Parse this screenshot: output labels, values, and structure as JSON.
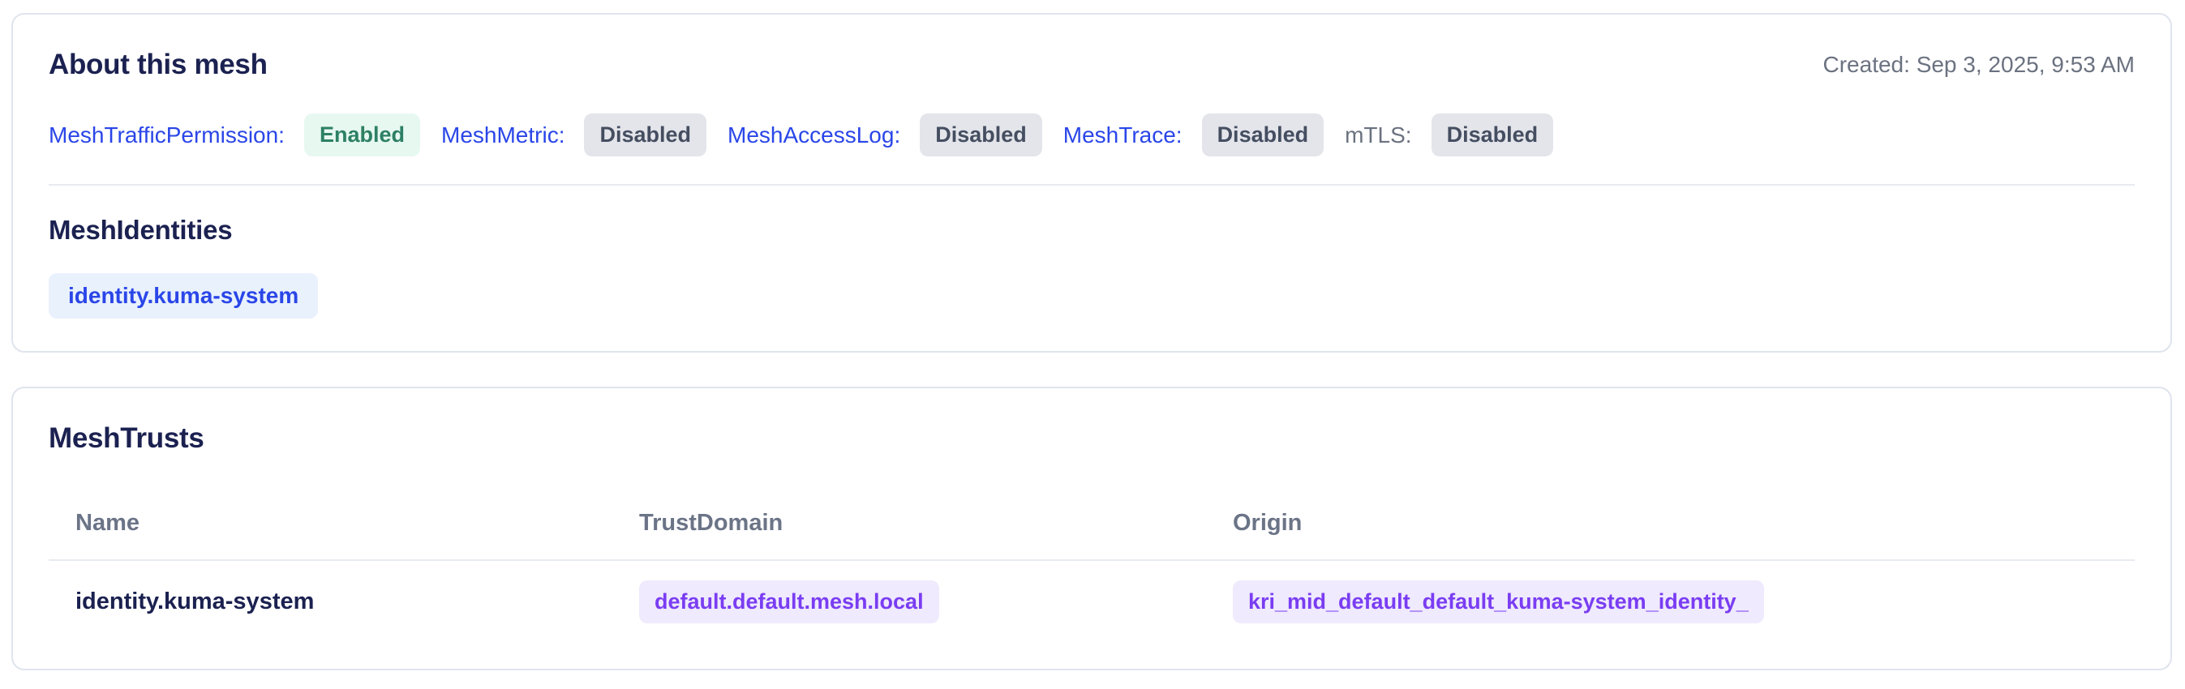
{
  "about_card": {
    "title": "About this mesh",
    "created": "Created: Sep 3, 2025, 9:53 AM",
    "policies": [
      {
        "label": "MeshTrafficPermission:",
        "status": "Enabled",
        "variant": "enabled",
        "is_link": true
      },
      {
        "label": "MeshMetric:",
        "status": "Disabled",
        "variant": "disabled",
        "is_link": true
      },
      {
        "label": "MeshAccessLog:",
        "status": "Disabled",
        "variant": "disabled",
        "is_link": true
      },
      {
        "label": "MeshTrace:",
        "status": "Disabled",
        "variant": "disabled",
        "is_link": true
      },
      {
        "label": "mTLS:",
        "status": "Disabled",
        "variant": "disabled",
        "is_link": false
      }
    ],
    "mesh_identities": {
      "title": "MeshIdentities",
      "items": [
        "identity.kuma-system"
      ]
    }
  },
  "mesh_trusts_card": {
    "title": "MeshTrusts",
    "table": {
      "columns": [
        "Name",
        "TrustDomain",
        "Origin"
      ],
      "rows": [
        {
          "name": "identity.kuma-system",
          "trust_domain": "default.default.mesh.local",
          "origin": "kri_mid_default_default_kuma-system_identity_"
        }
      ]
    }
  },
  "colors": {
    "link_blue": "#2a46e8",
    "heading_navy": "#1b2150",
    "muted_gray": "#6b7280",
    "table_header_gray": "#6b7487",
    "badge_enabled_bg": "#e7f8f1",
    "badge_enabled_text": "#2d8065",
    "badge_disabled_bg": "#e3e5ea",
    "badge_disabled_text": "#454e61",
    "chip_identity_bg": "#e9f1fd",
    "chip_purple_bg": "#efeafd",
    "chip_purple_text": "#7a3df2",
    "card_border": "#dfe4ed"
  }
}
